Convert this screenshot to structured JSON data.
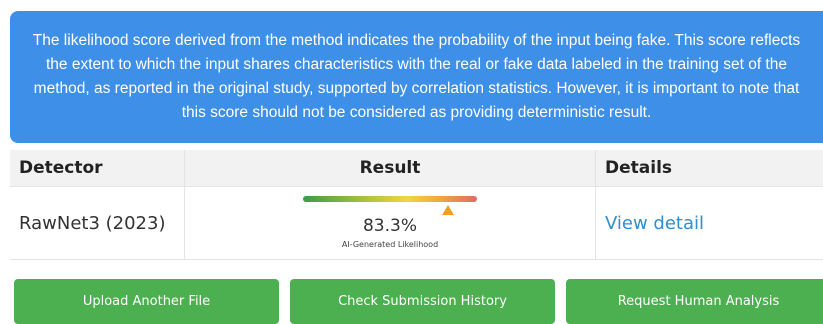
{
  "notice": {
    "lines": [
      "The likelihood score derived from the method indicates the probability of the input being fake. This score reflects",
      "the extent to which the input shares characteristics with the real or fake data labeled in the training set of the",
      "method, as reported in the original study, supported by correlation statistics. However, it is important to note that",
      "this score should not be considered as providing deterministic result."
    ],
    "background_color": "#3d8fe8"
  },
  "table": {
    "headers": {
      "detector": "Detector",
      "result": "Result",
      "details": "Details"
    },
    "rows": [
      {
        "detector": "RawNet3 (2023)",
        "score_text": "83.3%",
        "score_value": 0.833,
        "score_caption": "AI-Generated Likelihood",
        "details_link": "View detail"
      }
    ]
  },
  "actions": {
    "upload_label": "Upload Another File",
    "history_label": "Check Submission History",
    "human_label": "Request Human Analysis",
    "button_color": "#4caf50"
  },
  "colors": {
    "link": "#2f8fcf",
    "marker": "#f5a021"
  }
}
